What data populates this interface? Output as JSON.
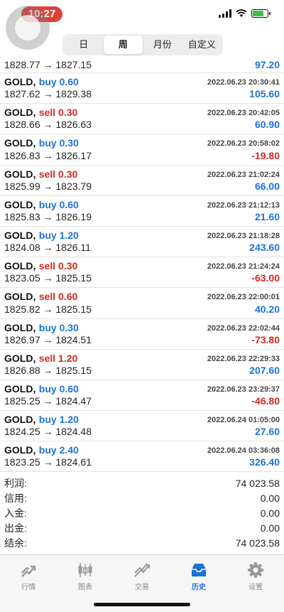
{
  "status_bar": {
    "time": "10:27"
  },
  "segmented": {
    "items": [
      {
        "label": "日"
      },
      {
        "label": "周"
      },
      {
        "label": "月份"
      },
      {
        "label": "自定义"
      }
    ]
  },
  "first_row": {
    "prices": "1828.77 → 1827.15",
    "profit": "97.20"
  },
  "trades": [
    {
      "symbol": "GOLD,",
      "direction": "buy 0.60",
      "datetime": "2022.06.23 20:30:41",
      "prices": "1827.62 → 1829.38",
      "profit": "105.60"
    },
    {
      "symbol": "GOLD,",
      "direction": "sell 0.30",
      "datetime": "2022.06.23 20:42:05",
      "prices": "1828.66 → 1826.63",
      "profit": "60.90"
    },
    {
      "symbol": "GOLD,",
      "direction": "buy 0.30",
      "datetime": "2022.06.23 20:58:02",
      "prices": "1826.83 → 1826.17",
      "profit": "-19.80"
    },
    {
      "symbol": "GOLD,",
      "direction": "sell 0.30",
      "datetime": "2022.06.23 21:02:24",
      "prices": "1825.99 → 1823.79",
      "profit": "66.00"
    },
    {
      "symbol": "GOLD,",
      "direction": "buy 0.60",
      "datetime": "2022.06.23 21:12:13",
      "prices": "1825.83 → 1826.19",
      "profit": "21.60"
    },
    {
      "symbol": "GOLD,",
      "direction": "buy 1.20",
      "datetime": "2022.06.23 21:18:28",
      "prices": "1824.08 → 1826.11",
      "profit": "243.60"
    },
    {
      "symbol": "GOLD,",
      "direction": "sell 0.30",
      "datetime": "2022.06.23 21:24:24",
      "prices": "1823.05 → 1825.15",
      "profit": "-63.00"
    },
    {
      "symbol": "GOLD,",
      "direction": "sell 0.60",
      "datetime": "2022.06.23 22:00:01",
      "prices": "1825.82 → 1825.15",
      "profit": "40.20"
    },
    {
      "symbol": "GOLD,",
      "direction": "buy 0.30",
      "datetime": "2022.06.23 22:02:44",
      "prices": "1826.97 → 1824.51",
      "profit": "-73.80"
    },
    {
      "symbol": "GOLD,",
      "direction": "sell 1.20",
      "datetime": "2022.06.23 22:29:33",
      "prices": "1826.88 → 1825.15",
      "profit": "207.60"
    },
    {
      "symbol": "GOLD,",
      "direction": "buy 0.60",
      "datetime": "2022.06.23 23:29:37",
      "prices": "1825.25 → 1824.47",
      "profit": "-46.80"
    },
    {
      "symbol": "GOLD,",
      "direction": "buy 1.20",
      "datetime": "2022.06.24 01:05:00",
      "prices": "1824.25 → 1824.48",
      "profit": "27.60"
    },
    {
      "symbol": "GOLD,",
      "direction": "buy 2.40",
      "datetime": "2022.06.24 03:36:08",
      "prices": "1823.25 → 1824.61",
      "profit": "326.40"
    }
  ],
  "summary": [
    {
      "label": "利润:",
      "value": "74 023.58"
    },
    {
      "label": "信用:",
      "value": "0.00"
    },
    {
      "label": "入金:",
      "value": "0.00"
    },
    {
      "label": "出金:",
      "value": "0.00"
    },
    {
      "label": "结余:",
      "value": "74 023.58"
    }
  ],
  "tabbar": {
    "items": [
      {
        "label": "行情",
        "icon": "quotes-icon"
      },
      {
        "label": "图表",
        "icon": "chart-icon"
      },
      {
        "label": "交易",
        "icon": "trade-icon"
      },
      {
        "label": "历史",
        "icon": "history-icon"
      },
      {
        "label": "设置",
        "icon": "gear-icon"
      }
    ]
  },
  "colors": {
    "buy": "#1a73d8",
    "sell": "#d0281e",
    "accent": "#1a73d8",
    "time_pill": "#e0403a"
  }
}
